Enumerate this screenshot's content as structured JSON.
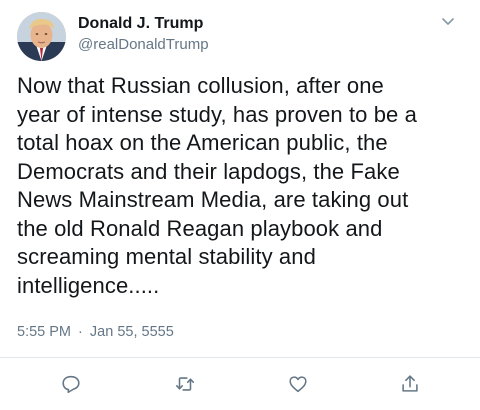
{
  "user": {
    "display_name": "Donald J. Trump",
    "handle": "@realDonaldTrump"
  },
  "tweet": {
    "text": "Now that Russian collusion, after one\nyear of intense study, has proven to be a\ntotal hoax on the American public, the\nDemocrats and their lapdogs, the Fake\nNews Mainstream Media, are taking out\nthe old Ronald Reagan playbook and\nscreaming mental stability and\nintelligence.....",
    "time": "5:55 PM",
    "separator": "·",
    "date": "Jan 55, 5555"
  },
  "icons": {
    "more": "chevron-down-icon",
    "reply": "reply-icon",
    "retweet": "retweet-icon",
    "like": "heart-icon",
    "share": "share-icon"
  },
  "colors": {
    "text": "#14171a",
    "secondary": "#657786",
    "icon": "#657786",
    "divider": "#e1e8ed"
  }
}
